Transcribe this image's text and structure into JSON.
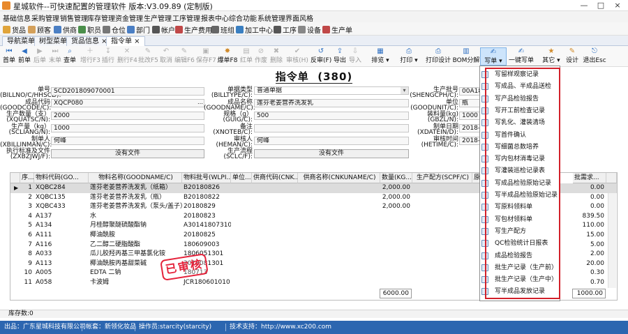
{
  "window": {
    "title": "星城软件--可快速配置的管理软件 版本:V3.09.89 (定制版)",
    "controls": [
      "—",
      "□",
      "×"
    ]
  },
  "menu": [
    "基础信息",
    "采购管理",
    "销售管理",
    "库存管理",
    "资金管理",
    "生产管理",
    "工序管理",
    "报表中心",
    "综合功能",
    "系统管理",
    "界面风格"
  ],
  "quickbar": [
    "货品",
    "顾客",
    "供商",
    "职员",
    "仓位",
    "部门",
    "帐户",
    "生产费用",
    "班组",
    "加工中心",
    "工序",
    "设备",
    "生产单"
  ],
  "tabs": [
    "导航菜单",
    "树型菜单",
    "货品信息 ×",
    "指令单 ×"
  ],
  "toolbar": [
    "首单",
    "前单",
    "后单",
    "末单",
    "查单",
    "增行F3",
    "插行",
    "删行F4",
    "批改F5",
    "取消",
    "编辑F6",
    "保存F7",
    "爆单F8",
    "红单",
    "作废",
    "删除",
    "审核(H)",
    "反审(F)",
    "导出",
    "导入",
    "排览 ▾",
    "打印 ▾",
    "打印设计",
    "BOM分解",
    "写单 ▾",
    "一键写单",
    "其它 ▾",
    "设计",
    "退出Esc"
  ],
  "document": {
    "title": "指令单",
    "count": "(380)"
  },
  "form": {
    "bill_no_label": "单号",
    "bill_no_code": "(BILLNO/C/HHSCD):",
    "bill_no": "SCD201809070001",
    "goods_code_label": "成品代码",
    "goods_code_code": "(GOODCODE/C):",
    "goods_code": "XQCP080",
    "qty_label": "生产数量（支）",
    "qty_code": "(XQUATSC/N):",
    "qty": "2000",
    "kg_label": "生产量（kg）",
    "kg_code": "(SCLIANG/N):",
    "kg": "1000",
    "maker_label": "制单人",
    "maker_code": "(XBILLINMAN/C):",
    "maker": "何峰",
    "standard_label": "执行标准及文件",
    "standard_code": "(ZXBZJWJ/F):",
    "standard_btn": "没有文件",
    "type_label": "单据类型",
    "type_code": "(BILLTYPE/C):",
    "type": "普通单据",
    "goods_name_label": "成品名称",
    "goods_name_code": "(GOODNAME/C):",
    "goods_name": "莲芬老姜营养洗发乳",
    "spec_label": "规格（g）",
    "spec_code": "(GUIG/C):",
    "spec": "500",
    "remark_label": "备注",
    "remark_code": "(XNOTEB/C):",
    "reviewer_label": "审核人",
    "reviewer_code": "(HEMAN/C):",
    "reviewer": "何峰",
    "process_label": "生产流程",
    "process_code": "(SCLC/F):",
    "process_btn": "没有文件",
    "batch_label": "生产批号",
    "batch_code": "(SHENGCPH/C):",
    "batch": "00A18",
    "unit_label": "单位",
    "unit_code": "(GOODUNIT/C):",
    "unit": "瓶",
    "fill_label": "装料量(kg)",
    "fill_code": "(GBZL/N):",
    "fill": "1000",
    "date_label": "制单日期",
    "date_code": "(XDATEIN/D):",
    "date": "2018-0",
    "review_time_label": "审核时间",
    "review_time_code": "(HETIME/C):",
    "review_time": "2018-0"
  },
  "grid": {
    "headers": [
      "序...",
      "物料代码(GO...",
      "物料名称(GOODNAME/C)",
      "物料批号(WLPI...",
      "单位...",
      "供商代码(CNK...",
      "供商名称(CNKUNAME/C)",
      "数量(KG...",
      "生产配方(SCPF/C)",
      "原材",
      "批需求..."
    ],
    "rows": [
      [
        "1",
        "XQBC284",
        "莲芬老姜营养洗发乳（纸箱）",
        "B20180826",
        "",
        "",
        "",
        "2,000.00",
        "",
        "",
        "0.00"
      ],
      [
        "2",
        "XQBC135",
        "莲芬老姜营养洗发乳（瓶）",
        "B20180822",
        "",
        "",
        "",
        "2,000.00",
        "",
        "",
        "0.00"
      ],
      [
        "3",
        "XQBC433",
        "莲芬老姜营养洗发乳（泵头/盖子）",
        "20180829",
        "",
        "",
        "",
        "2,000.00",
        "",
        "",
        "0.00"
      ],
      [
        "4",
        "A137",
        "水",
        "20180823",
        "",
        "",
        "",
        "",
        "",
        "",
        "839.50"
      ],
      [
        "5",
        "A134",
        "月桂醇聚醚硫酸酯钠",
        "A301418073101",
        "",
        "",
        "",
        "",
        "",
        "",
        "110.00"
      ],
      [
        "6",
        "A111",
        "椰油酰胺",
        "20180825",
        "",
        "",
        "",
        "",
        "",
        "",
        "15.00"
      ],
      [
        "7",
        "A116",
        "乙二醇二硬脂酸酯",
        "180609003",
        "",
        "",
        "",
        "",
        "",
        "",
        "5.00"
      ],
      [
        "8",
        "A033",
        "瓜儿胶羟丙基三甲基氯化铵",
        "1806051301",
        "",
        "",
        "",
        "",
        "",
        "",
        "2.00"
      ],
      [
        "9",
        "A113",
        "椰油酰胺丙基甜菜碱",
        "2018081301",
        "",
        "",
        "",
        "",
        "",
        "",
        "20.00"
      ],
      [
        "10",
        "A005",
        "EDTA 二钠",
        "180713",
        "",
        "",
        "",
        "",
        "",
        "",
        "0.30"
      ],
      [
        "11",
        "A058",
        "卡波姆",
        "JCR180601010",
        "",
        "",
        "",
        "",
        "",
        "",
        "0.70"
      ]
    ],
    "total_qty": "6000.00",
    "total_req": "1000.00"
  },
  "stamp": "已审核",
  "dropdown_items": [
    "写留样观察记录",
    "写成品、半成品送检",
    "写产品检验报告",
    "写开工前检查记录",
    "写乳化、灌装清场",
    "写首件确认",
    "写细菌总数培养",
    "写内包材消毒记录",
    "写灌装巡检记录表",
    "写成品检验原始记录",
    "写半成品检验原始记录",
    "写原料领料单",
    "写包材领料单",
    "写生产配方",
    "QC检验统计日报表",
    "成品检验报告",
    "批生产记录（生产前）",
    "批生产记录（生产中）",
    "写半成品发放记录"
  ],
  "footer": {
    "record_count": "库存数:0"
  },
  "status": [
    "出品：广东星城科技有限公司",
    "帐套：新领化妆品",
    "操作员:starcity(starcity)",
    "技术支持：http://www.xc200.com"
  ]
}
